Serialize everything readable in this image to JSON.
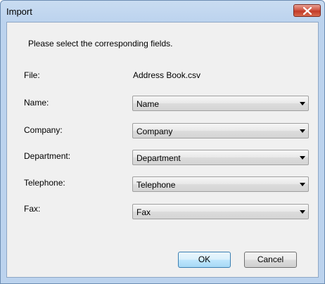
{
  "window": {
    "title": "Import"
  },
  "dialog": {
    "instruction": "Please select the corresponding fields.",
    "file_label": "File:",
    "file_value": "Address Book.csv",
    "fields": [
      {
        "label": "Name:",
        "selected": "Name"
      },
      {
        "label": "Company:",
        "selected": "Company"
      },
      {
        "label": "Department:",
        "selected": "Department"
      },
      {
        "label": "Telephone:",
        "selected": "Telephone"
      },
      {
        "label": "Fax:",
        "selected": "Fax"
      }
    ]
  },
  "buttons": {
    "ok_label": "OK",
    "cancel_label": "Cancel"
  },
  "colors": {
    "frame": "#bcd3ee",
    "client": "#f0f0f0",
    "close_button": "#c94a36",
    "ok_border": "#3c7fb1"
  },
  "icons": {
    "close": "close-icon",
    "dropdown": "chevron-down-icon"
  }
}
